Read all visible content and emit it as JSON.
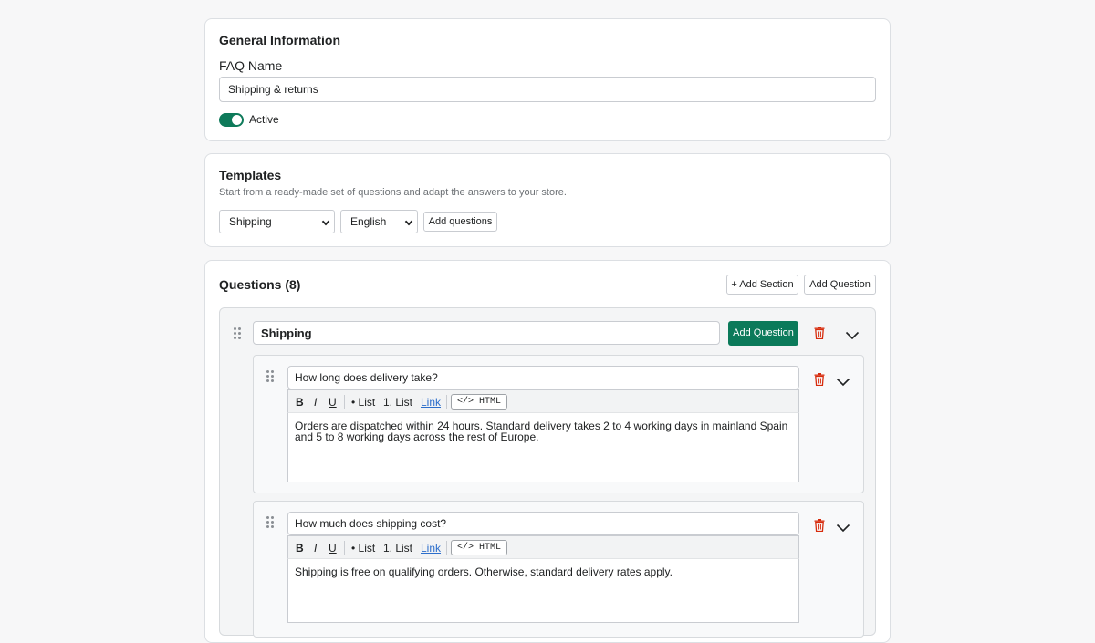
{
  "general": {
    "title": "General Information",
    "faq_name_label": "FAQ Name",
    "faq_name_value": "Shipping & returns",
    "active_label": "Active",
    "active": true
  },
  "templates": {
    "title": "Templates",
    "description": "Start from a ready-made set of questions and adapt the answers to your store.",
    "template_select": "Shipping",
    "language_select": "English",
    "add_questions_label": "Add questions"
  },
  "questions": {
    "title": "Questions (8)",
    "add_section_label": "+ Add Section",
    "add_question_label": "Add Question",
    "sections": [
      {
        "name": "Shipping",
        "add_question_label": "Add Question",
        "items": [
          {
            "question": "How long does delivery take?",
            "answer": "Orders are dispatched within 24 hours. Standard delivery takes 2 to 4 working days in mainland Spain and 5 to 8 working days across the rest of Europe."
          },
          {
            "question": "How much does shipping cost?",
            "answer": "Shipping is free on qualifying orders. Otherwise, standard delivery rates apply."
          }
        ]
      }
    ]
  },
  "toolbar": {
    "bold": "B",
    "italic": "I",
    "underline": "U",
    "bullet_list": "• List",
    "numbered_list": "1. List",
    "link": "Link",
    "html": "</> HTML"
  },
  "colors": {
    "primary": "#0b7a5a",
    "danger": "#d72c0d",
    "link": "#2c6ecb"
  }
}
